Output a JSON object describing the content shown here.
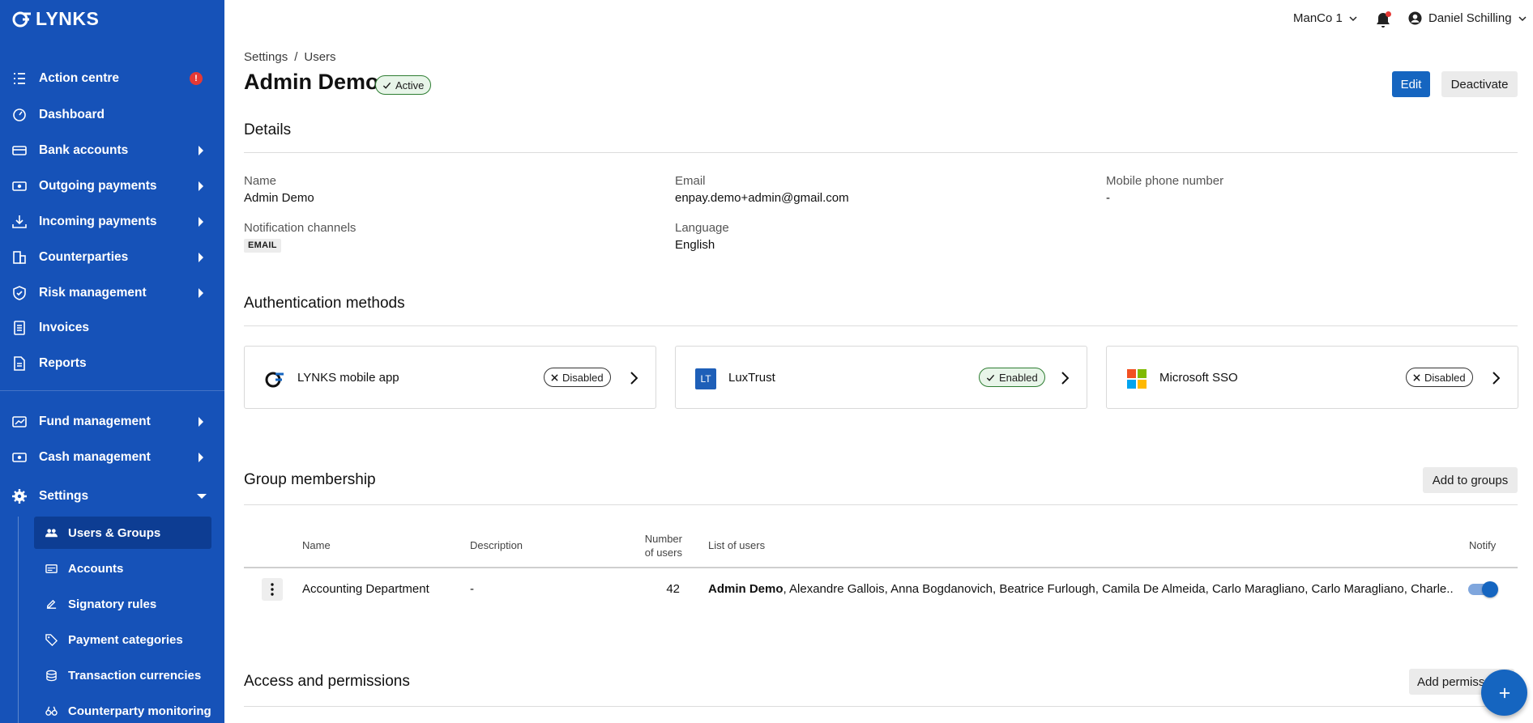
{
  "app": {
    "name": "LYNKS"
  },
  "sidebar": {
    "items": [
      {
        "label": "Action centre",
        "icon": "checklist-icon",
        "alert": "!"
      },
      {
        "label": "Dashboard",
        "icon": "dashboard-gauge-icon"
      },
      {
        "label": "Bank accounts",
        "icon": "bank-card-icon"
      },
      {
        "label": "Outgoing payments",
        "icon": "money-out-icon"
      },
      {
        "label": "Incoming payments",
        "icon": "download-tray-icon"
      },
      {
        "label": "Counterparties",
        "icon": "building-icon"
      },
      {
        "label": "Risk management",
        "icon": "shield-check-icon"
      },
      {
        "label": "Invoices",
        "icon": "document-icon"
      },
      {
        "label": "Reports",
        "icon": "report-icon"
      },
      {
        "label": "Fund management",
        "icon": "fund-chart-icon"
      },
      {
        "label": "Cash management",
        "icon": "cash-icon"
      },
      {
        "label": "Settings",
        "icon": "gear-icon"
      }
    ],
    "settings_sub": [
      {
        "label": "Users & Groups",
        "icon": "users-icon"
      },
      {
        "label": "Accounts",
        "icon": "accounts-card-icon"
      },
      {
        "label": "Signatory rules",
        "icon": "signature-icon"
      },
      {
        "label": "Payment categories",
        "icon": "tag-icon"
      },
      {
        "label": "Transaction currencies",
        "icon": "coins-icon"
      },
      {
        "label": "Counterparty monitoring",
        "icon": "binoculars-icon"
      }
    ]
  },
  "topbar": {
    "entity": "ManCo 1",
    "user": "Daniel Schilling"
  },
  "breadcrumb": {
    "first": "Settings",
    "sep": "/",
    "second": "Users"
  },
  "page": {
    "title": "Admin Demo",
    "status": "Active",
    "edit_label": "Edit",
    "deactivate_label": "Deactivate"
  },
  "details": {
    "title": "Details",
    "name_label": "Name",
    "name_value": "Admin Demo",
    "email_label": "Email",
    "email_value": "enpay.demo+admin@gmail.com",
    "phone_label": "Mobile phone number",
    "phone_value": "-",
    "notif_label": "Notification channels",
    "notif_value": "EMAIL",
    "lang_label": "Language",
    "lang_value": "English"
  },
  "auth": {
    "title": "Authentication methods",
    "methods": [
      {
        "name": "LYNKS mobile app",
        "status": "Disabled"
      },
      {
        "name": "LuxTrust",
        "status": "Enabled",
        "icon_text": "LT"
      },
      {
        "name": "Microsoft SSO",
        "status": "Disabled"
      }
    ]
  },
  "groups": {
    "title": "Group membership",
    "add_label": "Add to groups",
    "headers": {
      "name": "Name",
      "description": "Description",
      "num_line1": "Number",
      "num_line2": "of users",
      "list": "List of users",
      "notify": "Notify"
    },
    "rows": [
      {
        "name": "Accounting Department",
        "description": "-",
        "count": "42",
        "users_bold": "Admin Demo",
        "users_rest": ", Alexandre Gallois, Anna Bogdanovich, Beatrice Furlough, Camila De Almeida, Carlo Maragliano, Carlo Maragliano, Charle...",
        "notify": true
      }
    ]
  },
  "access": {
    "title": "Access and permissions",
    "add_label": "Add permiss"
  },
  "colors": {
    "sidebar": "#1652b8",
    "primary": "#1565c0",
    "active_nav": "#0d3d93",
    "alert": "#e53935"
  }
}
